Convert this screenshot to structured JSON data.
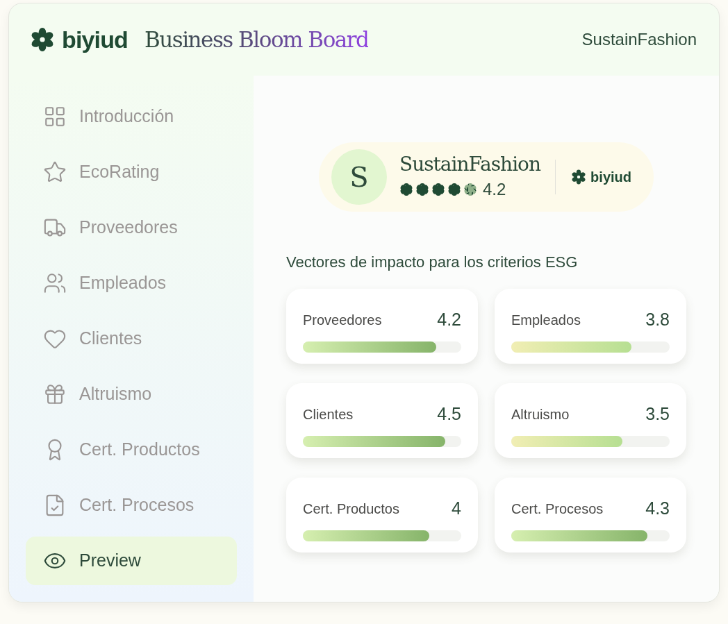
{
  "header": {
    "logo": "biyiud",
    "title_part_1": "Business",
    "title_part_2": "Bloom Board",
    "company": "SustainFashion"
  },
  "sidebar": {
    "items": [
      {
        "label": "Introducción",
        "selected": false
      },
      {
        "label": "EcoRating",
        "selected": false
      },
      {
        "label": "Proveedores",
        "selected": false
      },
      {
        "label": "Empleados",
        "selected": false
      },
      {
        "label": "Clientes",
        "selected": false
      },
      {
        "label": "Altruismo",
        "selected": false
      },
      {
        "label": "Cert. Productos",
        "selected": false
      },
      {
        "label": "Cert. Procesos",
        "selected": false
      },
      {
        "label": "Preview",
        "selected": true
      }
    ]
  },
  "profile": {
    "initial": "S",
    "name": "SustainFashion",
    "stars": 4.2,
    "rating": "4.2",
    "brand": "biyiud"
  },
  "section_title": "Vectores de impacto para los criterios ESG",
  "vectors": [
    {
      "label": "Proveedores",
      "score": "4.2",
      "level": 0.84,
      "kind": "green"
    },
    {
      "label": "Empleados",
      "score": "3.8",
      "level": 0.76,
      "kind": "yellow"
    },
    {
      "label": "Clientes",
      "score": "4.5",
      "level": 0.9,
      "kind": "green"
    },
    {
      "label": "Altruismo",
      "score": "3.5",
      "level": 0.7,
      "kind": "yellow"
    },
    {
      "label": "Cert. Productos",
      "score": "4",
      "level": 0.8,
      "kind": "green"
    },
    {
      "label": "Cert. Procesos",
      "score": "4.3",
      "level": 0.86,
      "kind": "green"
    }
  ]
}
